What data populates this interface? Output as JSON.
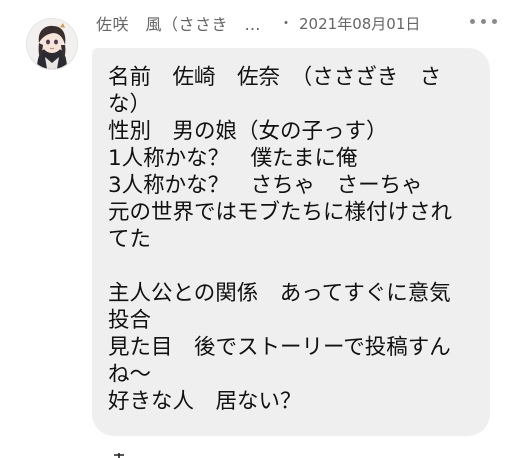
{
  "post": {
    "author_name": "佐咲　風（ささき　…",
    "separator": "・",
    "date": "2021年08月01日",
    "more_button_icon": "more-dots-icon",
    "avatar_icon": "anime-girl-avatar",
    "message": "名前　佐崎　佐奈　（ささざき　さ\nな）\n性別　男の娘（女の子っす）\n1人称かな？　僕たまに俺\n3人称かな？　さちゃ　さーちゃ\n元の世界ではモブたちに様付けされ\nてた\n\n主人公との関係　あってすぐに意気\n投合\n見た目　後でストーリーで投稿すん\nね〜\n好きな人　居ない？"
  },
  "colors": {
    "bubble_bg": "#efefef",
    "meta_text": "#666666",
    "message_text": "#111111"
  }
}
